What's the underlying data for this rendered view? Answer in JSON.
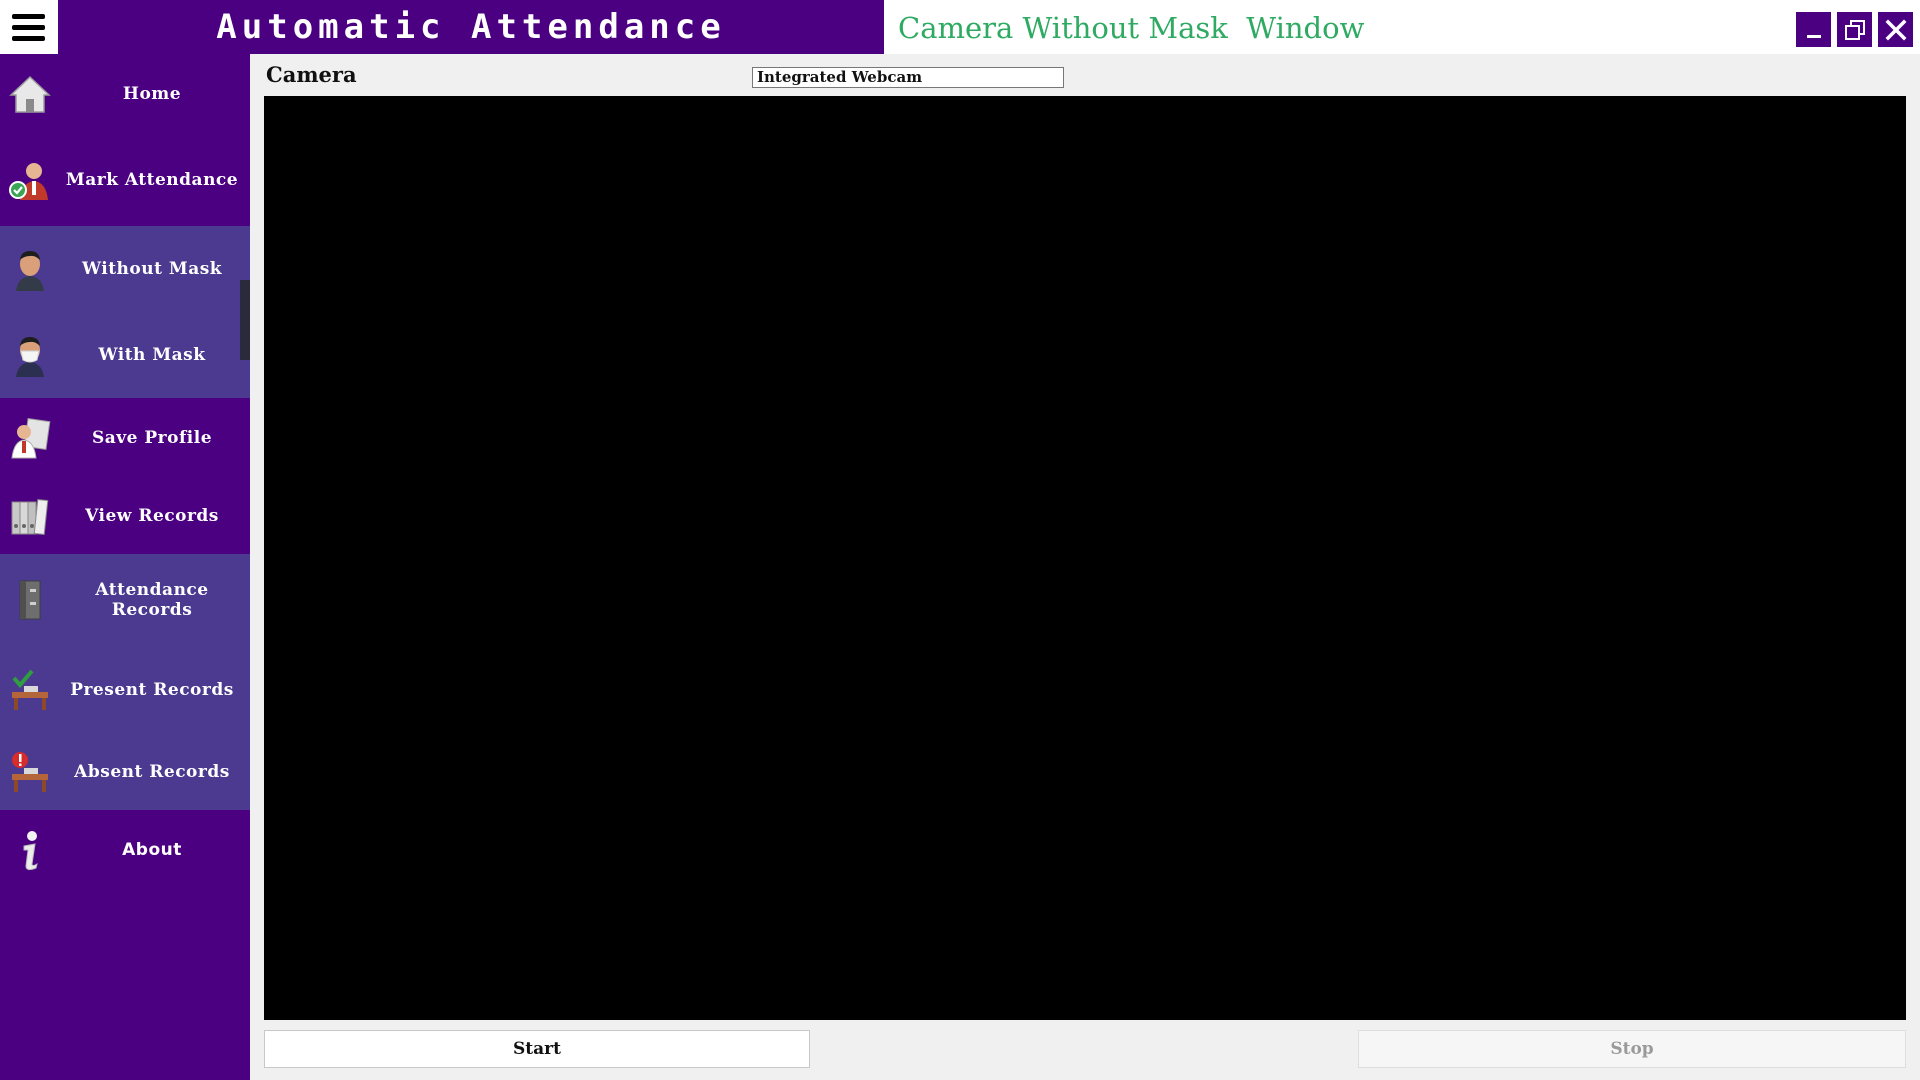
{
  "app": {
    "banner_title": "Automatic Attendance",
    "window_title": "Camera Without Mask  Window"
  },
  "window_controls": {
    "minimize": "minimize-icon",
    "maximize": "restore-icon",
    "close": "close-icon"
  },
  "sidebar": {
    "items": [
      {
        "label": "Home",
        "icon": "home-icon"
      },
      {
        "label": "Mark Attendance",
        "icon": "person-check-icon"
      },
      {
        "label": "Without Mask",
        "icon": "face-icon"
      },
      {
        "label": "With Mask",
        "icon": "face-mask-icon"
      },
      {
        "label": "Save Profile",
        "icon": "save-profile-icon"
      },
      {
        "label": "View Records",
        "icon": "binders-icon"
      },
      {
        "label": "Attendance Records",
        "icon": "cabinet-icon"
      },
      {
        "label": "Present Records",
        "icon": "desk-check-icon"
      },
      {
        "label": "Absent Records",
        "icon": "desk-alert-icon"
      },
      {
        "label": "About",
        "icon": "info-icon"
      }
    ],
    "selected": "Without Mask"
  },
  "camera": {
    "label": "Camera",
    "selected_device": "Integrated Webcam"
  },
  "actions": {
    "start": "Start",
    "stop": "Stop"
  },
  "colors": {
    "accent": "#4b0082",
    "highlight": "#4b3a8f",
    "title_green": "#2eaa62",
    "video_bg": "#000000"
  }
}
